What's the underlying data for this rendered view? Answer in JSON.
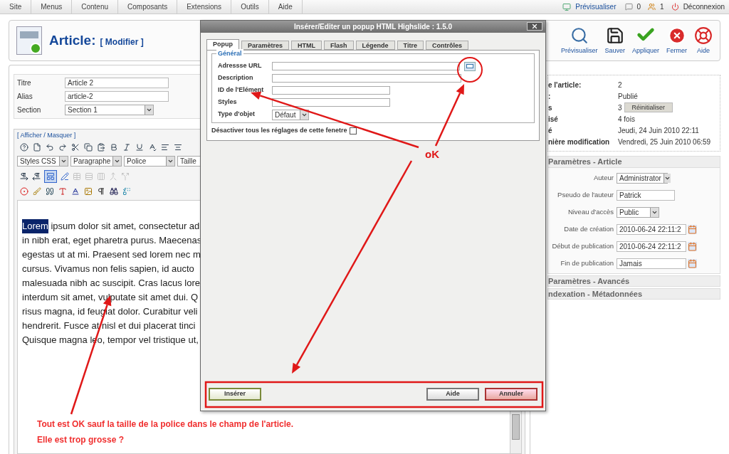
{
  "menu_bar": {
    "items": [
      "Site",
      "Menus",
      "Contenu",
      "Composants",
      "Extensions",
      "Outils",
      "Aide"
    ],
    "preview_link": "Prévisualiser",
    "messages_count": "0",
    "users_count": "1",
    "logout_link": "Déconnexion"
  },
  "header": {
    "title": "Article:",
    "subtitle": "[ Modifier ]",
    "actions": [
      {
        "kind": "preview",
        "label": "Prévisualiser"
      },
      {
        "kind": "save",
        "label": "Sauver"
      },
      {
        "kind": "apply",
        "label": "Appliquer"
      },
      {
        "kind": "close",
        "label": "Fermer"
      },
      {
        "kind": "help",
        "label": "Aide"
      }
    ]
  },
  "article_form": {
    "fields": [
      {
        "label": "Titre",
        "kind": "text",
        "value": "Article 2"
      },
      {
        "label": "Alias",
        "kind": "text",
        "value": "article-2"
      },
      {
        "label": "Section",
        "kind": "select",
        "value": "Section 1"
      }
    ]
  },
  "editor": {
    "toggle_link": "[ Afficher / Masquer ]",
    "selects": [
      "Styles CSS",
      "Paragraphe",
      "Police",
      "Taille"
    ],
    "visual_aid_on": true,
    "table_tools_disabled": true,
    "selected_word": "Lorem",
    "lines": [
      "ipsum dolor sit amet, consectetur ad",
      "in nibh erat, eget pharetra purus. Maecenas",
      "egestas ut at mi. Praesent sed lorem nec m",
      "cursus. Vivamus non felis sapien, id aucto",
      "malesuada nibh ac suscipit. Cras lacus lore",
      "interdum sit amet, vulputate sit amet dui. Q",
      "risus magna, id feugiat dolor. Curabitur veli",
      "hendrerit. Fusce at nisl et dui placerat tinci",
      "Quisque magna leo, tempor vel tristique ut,"
    ]
  },
  "dialog": {
    "title": "Insérer/Editer un popup HTML Highslide : 1.5.0",
    "tabs": [
      {
        "label": "Popup",
        "selected": true
      },
      {
        "label": "Paramètres",
        "selected": false
      },
      {
        "label": "HTML",
        "selected": false
      },
      {
        "label": "Flash",
        "selected": false
      },
      {
        "label": "Légende",
        "selected": false
      },
      {
        "label": "Titre",
        "selected": false
      },
      {
        "label": "Contrôles",
        "selected": false
      }
    ],
    "legend": "Général",
    "fields": [
      {
        "label": "Adressse URL",
        "kind": "browse"
      },
      {
        "label": "Description",
        "kind": "wide"
      },
      {
        "label": "ID de l'Elément",
        "kind": "short"
      },
      {
        "label": "Styles",
        "kind": "short"
      },
      {
        "label": "Type d'objet",
        "kind": "select",
        "value": "Défaut"
      }
    ],
    "disable_checkbox": {
      "label": "Désactiver tous les réglages de cette fenetre",
      "checked": false
    },
    "buttons": [
      {
        "kind": "insert",
        "label": "Insérer"
      },
      {
        "kind": "help",
        "label": "Aide"
      },
      {
        "kind": "cancel",
        "label": "Annuler"
      }
    ]
  },
  "info": {
    "rows": [
      {
        "label": "e l'article:",
        "value": "2"
      },
      {
        "label": ":",
        "value": "Publié"
      },
      {
        "label": "s",
        "value": "3",
        "button": "Réinitialiser"
      },
      {
        "label": "isé",
        "value": "4 fois"
      },
      {
        "label": "é",
        "value": "Jeudi, 24 Juin 2010 22:11"
      },
      {
        "label": "nière modification",
        "value": "Vendredi, 25 Juin 2010 06:59"
      }
    ]
  },
  "parameters": {
    "title": "Paramètres - Article",
    "fields": [
      {
        "label": "Auteur",
        "kind": "select",
        "value": "Administrator"
      },
      {
        "label": "Pseudo de l'auteur",
        "kind": "text",
        "value": "Patrick"
      },
      {
        "label": "Niveau d'accès",
        "kind": "select",
        "value": "Public"
      },
      {
        "label": "Date de création",
        "kind": "date",
        "value": "2010-06-24 22:11:2"
      },
      {
        "label": "Début de publication",
        "kind": "date",
        "value": "2010-06-24 22:11:2"
      },
      {
        "label": "Fin de publication",
        "kind": "date",
        "value": "Jamais"
      }
    ]
  },
  "collapsed_sections": [
    "Paramètres - Avancés",
    "ndexation - Métadonnées"
  ],
  "annotations": {
    "ok_label": "oK",
    "note_lines": [
      "Tout est OK sauf la taille de la police dans le champ de l'article.",
      "Elle est trop grosse ?"
    ]
  }
}
